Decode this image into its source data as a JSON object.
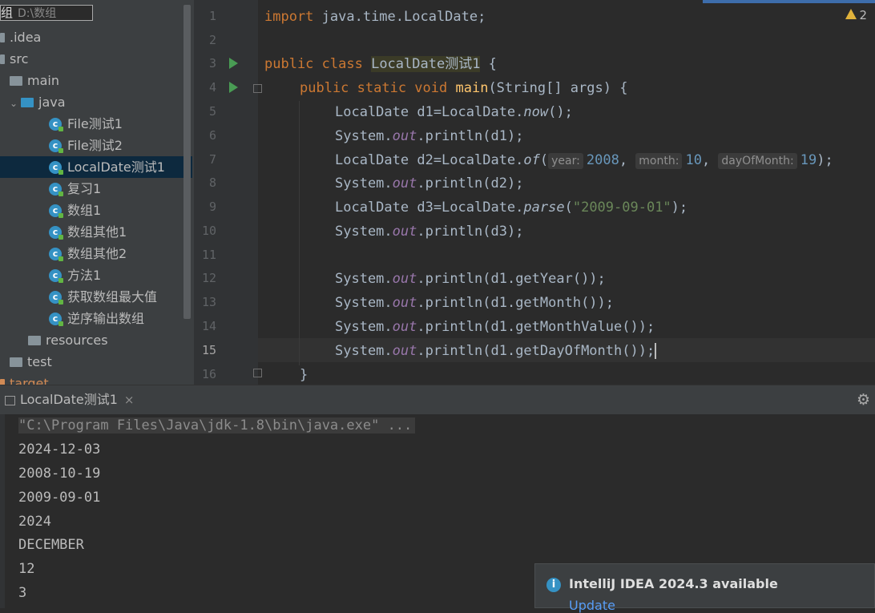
{
  "project": {
    "root_label": "组",
    "root_path": "D:\\数组",
    "items": [
      {
        "label": ".idea"
      },
      {
        "label": "src"
      },
      {
        "label": "main"
      },
      {
        "label": "java"
      },
      {
        "label": "File测试1"
      },
      {
        "label": "File测试2"
      },
      {
        "label": "LocalDate测试1"
      },
      {
        "label": "复习1"
      },
      {
        "label": "数组1"
      },
      {
        "label": "数组其他1"
      },
      {
        "label": "数组其他2"
      },
      {
        "label": "方法1"
      },
      {
        "label": "获取数组最大值"
      },
      {
        "label": "逆序输出数组"
      },
      {
        "label": "resources"
      },
      {
        "label": "test"
      },
      {
        "label": "target"
      }
    ]
  },
  "editor": {
    "line_numbers": [
      "1",
      "2",
      "3",
      "4",
      "5",
      "6",
      "7",
      "8",
      "9",
      "10",
      "11",
      "12",
      "13",
      "14",
      "15",
      "16"
    ],
    "current_line": "15",
    "warning_count": "2",
    "hints": {
      "year": "year:",
      "month": "month:",
      "day": "dayOfMonth:"
    },
    "code": {
      "l1_kw": "import",
      "l1_rest": " java.time.LocalDate;",
      "l3_kw": "public class",
      "l3_name": "LocalDate测试1",
      "l3_rest": " {",
      "l4_kw": "public static void",
      "l4_name": "main",
      "l4_rest": "(String[] args) {",
      "l5": "LocalDate d1=LocalDate.",
      "l5_m": "now",
      "l5_end": "();",
      "sys": "System.",
      "out": "out",
      "println_d1": ".println(d1);",
      "l7": "LocalDate d2=LocalDate.",
      "l7_m": "of",
      "l7_y": "2008",
      "l7_mo": "10",
      "l7_d": "19",
      "l7_end": ");",
      "println_d2": ".println(d2);",
      "l9": "LocalDate d3=LocalDate.",
      "l9_m": "parse",
      "l9_s": "\"2009-09-01\"",
      "l9_end": ");",
      "println_d3": ".println(d3);",
      "l12": ".println(d1.getYear());",
      "l13": ".println(d1.getMonth());",
      "l14": ".println(d1.getMonthValue());",
      "l15": ".println(d1.getDayOfMonth());",
      "l16": "}"
    }
  },
  "run": {
    "tab_label": "LocalDate测试1",
    "command": "\"C:\\Program Files\\Java\\jdk-1.8\\bin\\java.exe\" ...",
    "output": [
      "2024-12-03",
      "2008-10-19",
      "2009-09-01",
      "2024",
      "DECEMBER",
      "12",
      "3"
    ]
  },
  "notification": {
    "title": "IntelliJ IDEA 2024.3 available",
    "link": "Update"
  },
  "colors": {
    "accent": "#3592c4",
    "keyword": "#cc7832",
    "string": "#6a8759",
    "number": "#6897bb",
    "static_field": "#9876aa",
    "method_decl": "#ffc66d"
  }
}
